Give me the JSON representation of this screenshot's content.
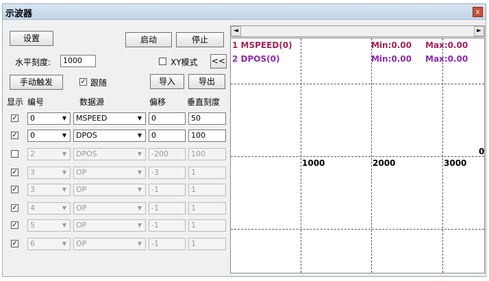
{
  "window": {
    "title": "示波器",
    "close_glyph": "x"
  },
  "buttons": {
    "settings": "设置",
    "start": "启动",
    "stop": "停止",
    "trigger": "手动触发",
    "import": "导入",
    "export": "导出",
    "collapse": "<<"
  },
  "horizontal_scale": {
    "label": "水平刻度:",
    "value": "1000"
  },
  "xy_mode": {
    "label": "XY模式",
    "checked": false
  },
  "follow": {
    "label": "跟随",
    "checked": true
  },
  "table": {
    "headers": {
      "show": "显示",
      "index": "编号",
      "source": "数据源",
      "offset": "偏移",
      "vscale": "垂直刻度"
    },
    "rows": [
      {
        "show": true,
        "index": "0",
        "source": "MSPEED",
        "offset": "0",
        "vscale": "50",
        "enabled": true
      },
      {
        "show": true,
        "index": "0",
        "source": "DPOS",
        "offset": "0",
        "vscale": "100",
        "enabled": true
      },
      {
        "show": false,
        "index": "2",
        "source": "DPOS",
        "offset": "-200",
        "vscale": "100",
        "enabled": false
      },
      {
        "show": true,
        "index": "3",
        "source": "OP",
        "offset": "-3",
        "vscale": "1",
        "enabled": false
      },
      {
        "show": true,
        "index": "3",
        "source": "OP",
        "offset": "-1",
        "vscale": "1",
        "enabled": false
      },
      {
        "show": true,
        "index": "4",
        "source": "OP",
        "offset": "-1",
        "vscale": "1",
        "enabled": false
      },
      {
        "show": true,
        "index": "5",
        "source": "OP",
        "offset": "-1",
        "vscale": "1",
        "enabled": false
      },
      {
        "show": true,
        "index": "6",
        "source": "OP",
        "offset": "-1",
        "vscale": "1",
        "enabled": false
      }
    ]
  },
  "scope": {
    "channels": [
      {
        "label": "1 MSPEED(0)",
        "min": "Min:0.00",
        "max": "Max:0.00",
        "color": "#a0225a"
      },
      {
        "label": "2 DPOS(0)",
        "min": "Min:0.00",
        "max": "Max:0.00",
        "color": "#8b2bb0"
      }
    ],
    "x_ticks": [
      "1000",
      "2000",
      "3000"
    ],
    "y_zero_label": "0",
    "scroll_left": "◄",
    "scroll_right": "►"
  }
}
